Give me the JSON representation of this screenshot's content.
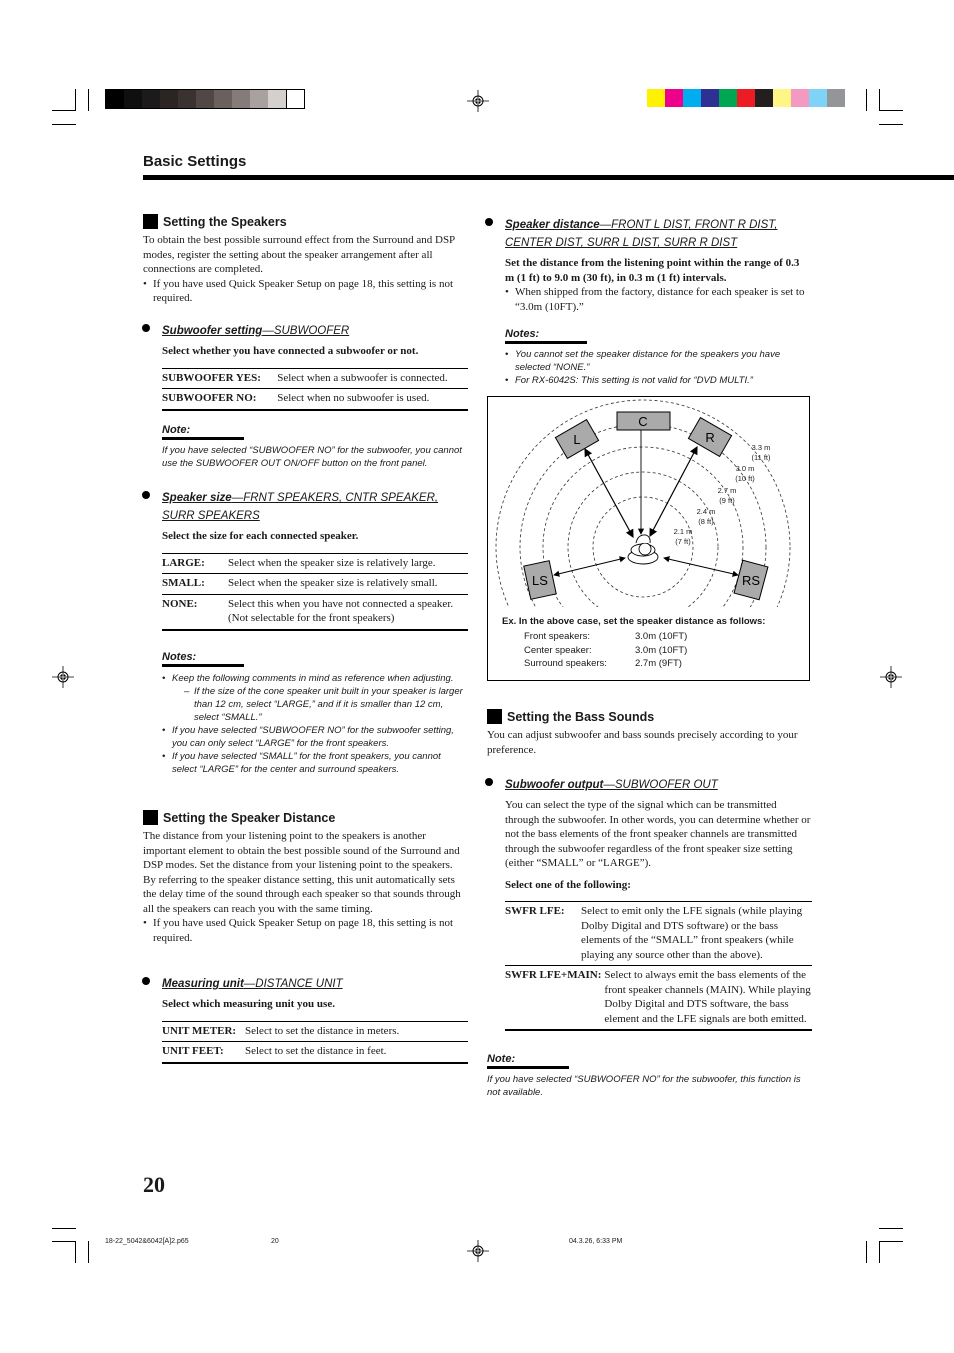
{
  "print_marks": {
    "grayscale_swatches": [
      "#000000",
      "#0f0f0f",
      "#1c1a1a",
      "#2a2523",
      "#3a3230",
      "#514846",
      "#6a615e",
      "#857c79",
      "#a9a19f",
      "#d5cfce",
      "#ffffff"
    ],
    "color_swatches": [
      "#fff200",
      "#ec008c",
      "#00aeef",
      "#2e3192",
      "#00a651",
      "#ed1c24",
      "#231f20",
      "#fff685",
      "#f49ac2",
      "#7fd3f7",
      "#939598"
    ]
  },
  "header": {
    "title": "Basic Settings"
  },
  "left": {
    "speakers_section": {
      "title": "Setting the Speakers",
      "intro": "To obtain the best possible surround effect from the Surround and DSP modes, register the setting about the speaker arrangement after all connections are completed.",
      "intro_bullet": "If you have used Quick Speaker Setup on page 18, this setting is not required."
    },
    "subwoofer_setting": {
      "title_main": "Subwoofer setting",
      "title_code": "—SUBWOOFER",
      "instruction": "Select whether you have connected a subwoofer or not.",
      "options": [
        {
          "key": "SUBWOOFER YES:",
          "desc": "Select when a subwoofer is connected."
        },
        {
          "key": "SUBWOOFER NO:",
          "desc": "Select when no subwoofer is used."
        }
      ],
      "note_head": "Note:",
      "note": "If you have selected “SUBWOOFER NO” for the subwoofer, you cannot use the SUBWOOFER OUT ON/OFF button on the front panel."
    },
    "speaker_size": {
      "title_main": "Speaker size",
      "title_code": "—FRNT SPEAKERS, CNTR SPEAKER, SURR SPEAKERS",
      "instruction": "Select the size for each connected speaker.",
      "options": [
        {
          "key": "LARGE:",
          "desc": "Select when the speaker size is relatively large."
        },
        {
          "key": "SMALL:",
          "desc": "Select when the speaker size is relatively small."
        },
        {
          "key": "NONE:",
          "desc": "Select this when you have not connected a speaker. (Not selectable for the front speakers)"
        }
      ],
      "notes_head": "Notes:",
      "notes": [
        "Keep the following comments in mind as reference when adjusting.",
        "If you have selected “SUBWOOFER NO” for the subwoofer setting, you can only select “LARGE” for the front speakers.",
        "If you have selected “SMALL” for the front speakers, you cannot select “LARGE” for the center and surround speakers."
      ],
      "sub_note": "If the size of the cone speaker unit built in your speaker is larger than 12 cm, select “LARGE,” and if it is smaller than 12 cm, select “SMALL.”"
    },
    "distance_section": {
      "title": "Setting the Speaker Distance",
      "para1": "The distance from your listening point to the speakers is another important element to obtain the best possible sound of the Surround and DSP modes. Set the distance from your listening point to the speakers.",
      "para2": "By referring to the speaker distance setting, this unit automatically sets the delay time of the sound through each speaker so that sounds through all the speakers can reach you with the same timing.",
      "bullet": "If you have used Quick Speaker Setup on page 18, this setting is not required."
    },
    "measuring_unit": {
      "title_main": "Measuring unit",
      "title_code": "—DISTANCE UNIT",
      "instruction": "Select which measuring unit you use.",
      "options": [
        {
          "key": "UNIT METER:",
          "desc": "Select to set the distance in meters."
        },
        {
          "key": "UNIT FEET:",
          "desc": "Select to set the distance in feet."
        }
      ]
    }
  },
  "right": {
    "speaker_distance": {
      "title_main": "Speaker distance",
      "title_code": "—FRONT L DIST, FRONT R DIST, CENTER DIST, SURR L DIST, SURR R DIST",
      "instruction": "Set the distance from the listening point within the range of 0.3 m (1 ft) to 9.0 m (30 ft), in 0.3 m (1 ft) intervals.",
      "bullet": "When shipped from the factory, distance for each speaker is set to “3.0m (10FT).”",
      "notes_head": "Notes:",
      "notes": [
        "You cannot set the speaker distance for the speakers you have selected “NONE.”",
        "For RX-6042S: This setting is not valid for “DVD MULTI.”"
      ]
    },
    "diagram": {
      "speakers": [
        "L",
        "C",
        "R",
        "LS",
        "RS"
      ],
      "rings": [
        {
          "m": "2.1 m",
          "ft": "(7 ft)"
        },
        {
          "m": "2.4 m",
          "ft": "(8 ft)"
        },
        {
          "m": "2.7 m",
          "ft": "(9 ft)"
        },
        {
          "m": "3.0 m",
          "ft": "(10 ft)"
        },
        {
          "m": "3.3 m",
          "ft": "(11 ft)"
        }
      ],
      "example_title": "Ex. In the above case, set the speaker distance as follows:",
      "example_rows": [
        {
          "label": "Front speakers:",
          "value": "3.0m (10FT)"
        },
        {
          "label": "Center speaker:",
          "value": "3.0m (10FT)"
        },
        {
          "label": "Surround speakers:",
          "value": "2.7m (9FT)"
        }
      ]
    },
    "bass_section": {
      "title": "Setting the Bass Sounds",
      "intro": "You can adjust subwoofer and bass sounds precisely according to your preference."
    },
    "subwoofer_output": {
      "title_main": "Subwoofer output",
      "title_code": "—SUBWOOFER OUT",
      "para": "You can select the type of the signal which can be transmitted through the subwoofer. In other words, you can determine whether or not the bass elements of the front speaker channels are transmitted through the subwoofer regardless of the front speaker size setting (either “SMALL” or “LARGE”).",
      "instruction": "Select one of the following:",
      "options": [
        {
          "key": "SWFR LFE:",
          "desc": "Select to emit only the LFE signals (while playing Dolby Digital and DTS software) or the bass elements of the “SMALL” front speakers (while playing any source other than the above)."
        },
        {
          "key": "SWFR LFE+MAIN:",
          "desc": "Select to always emit the bass elements of the front speaker channels (MAIN). While playing Dolby Digital and DTS software, the bass element and the LFE signals are both emitted."
        }
      ],
      "note_head": "Note:",
      "note": "If you have selected “SUBWOOFER NO” for the subwoofer, this function is not available."
    }
  },
  "footer": {
    "page_number": "20",
    "file_name": "18-22_5042&6042[A]2.p65",
    "file_page": "20",
    "timestamp": "04.3.26, 6:33 PM"
  }
}
